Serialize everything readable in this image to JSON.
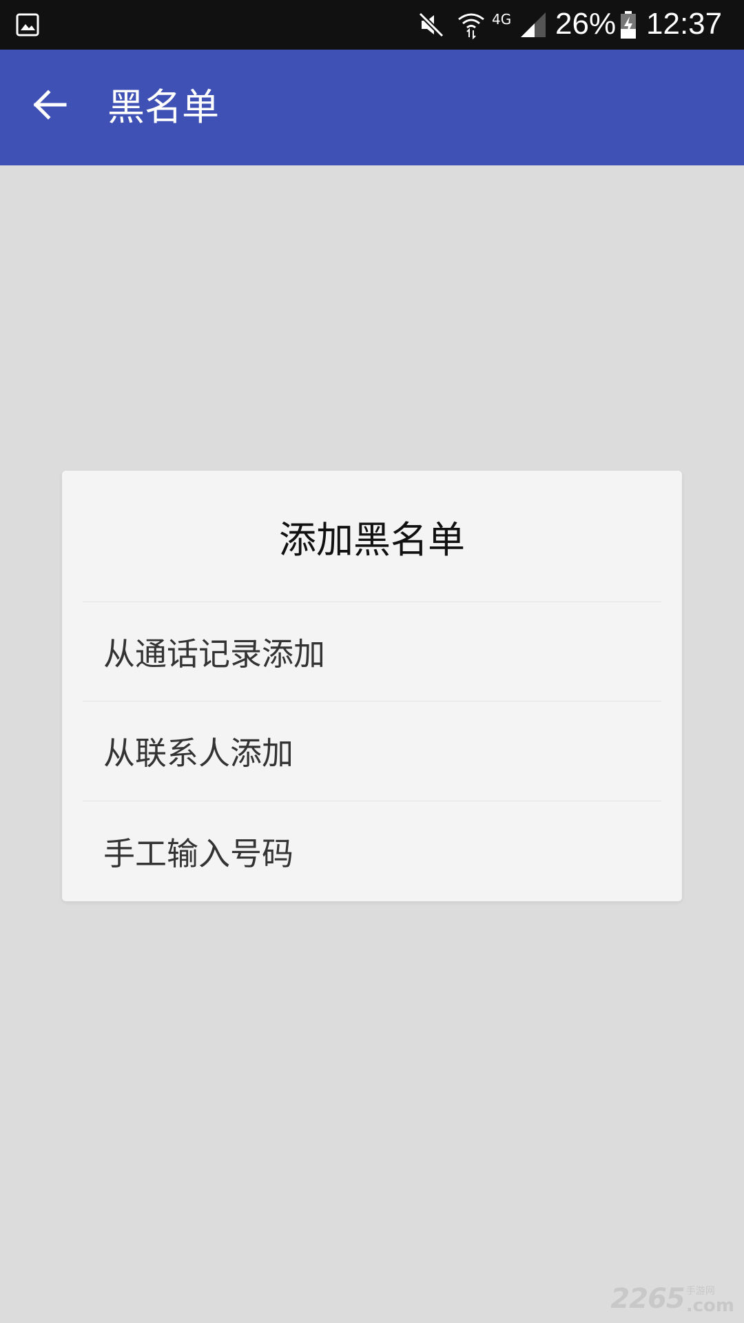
{
  "status_bar": {
    "gallery_icon": "image-icon",
    "mute_icon": "mute-icon",
    "wifi_icon": "wifi-icon",
    "network_type": "4G",
    "signal_icon": "signal-icon",
    "battery_percent": "26%",
    "battery_icon": "battery-charging-icon",
    "time": "12:37"
  },
  "app_bar": {
    "back_icon": "arrow-left-icon",
    "title": "黑名单",
    "color": "#3f51b5"
  },
  "dialog": {
    "title": "添加黑名单",
    "items": [
      {
        "label": "从通话记录添加"
      },
      {
        "label": "从联系人添加"
      },
      {
        "label": "手工输入号码"
      }
    ]
  },
  "watermark": {
    "number": "2265",
    "site_cn": "手游网",
    "domain": ".com"
  }
}
